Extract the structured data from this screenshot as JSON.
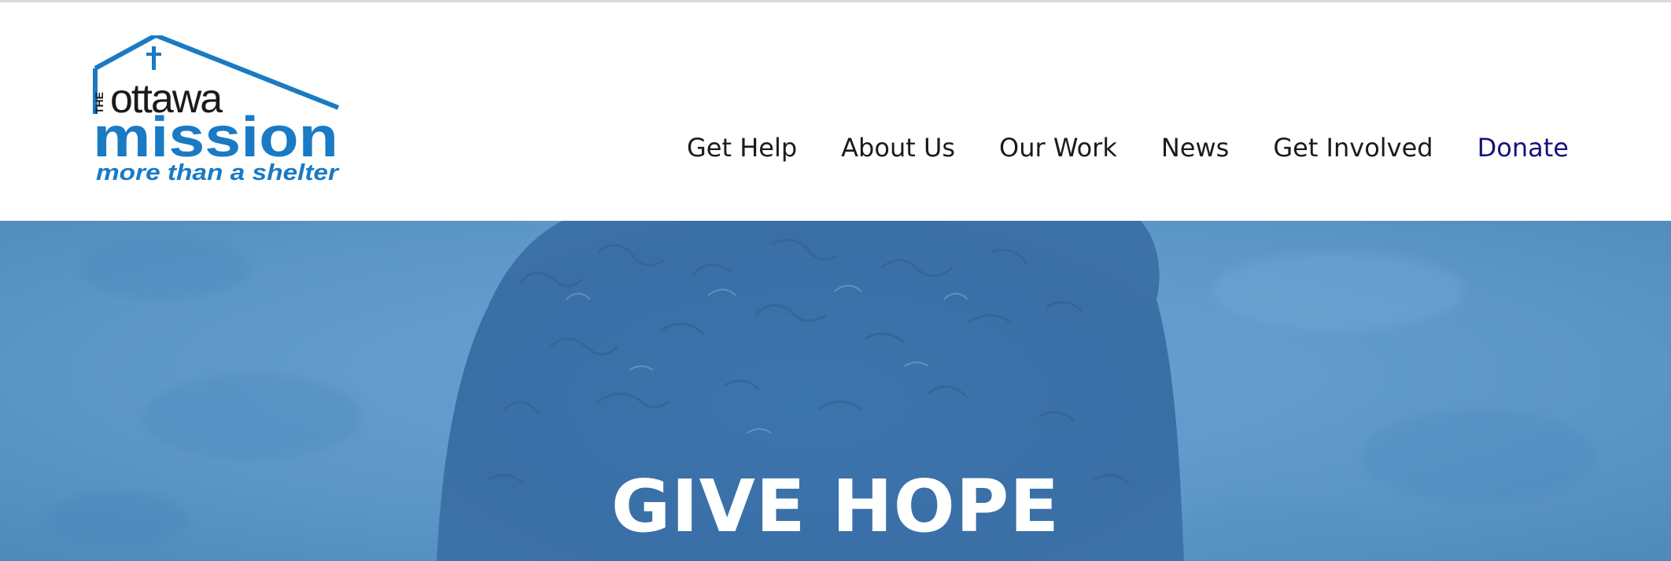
{
  "logo": {
    "the": "THE",
    "ottawa": "ottawa",
    "mission": "mission",
    "tagline": "more than a shelter",
    "cross_icon": "cross-icon",
    "brand_color": "#1a7ac4"
  },
  "nav": {
    "items": [
      {
        "label": "Get Help"
      },
      {
        "label": "About Us"
      },
      {
        "label": "Our Work"
      },
      {
        "label": "News"
      },
      {
        "label": "Get Involved"
      }
    ],
    "donate_label": "Donate",
    "donate_color": "#14147a"
  },
  "hero": {
    "title": "GIVE HOPE",
    "overlay_color": "#5a94c7"
  }
}
